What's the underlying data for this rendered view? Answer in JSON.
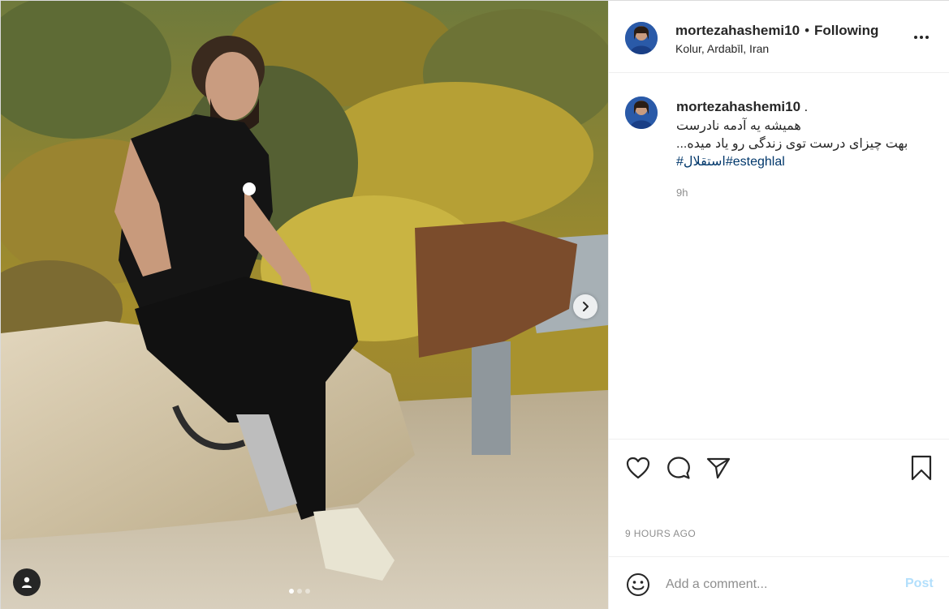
{
  "post": {
    "username": "mortezahashemi10",
    "follow_state": "Following",
    "header_separator": "•",
    "location": "Kolur, Ardabīl, Iran",
    "caption": {
      "username": "mortezahashemi10",
      "username_suffix": ".",
      "lines": [
        "همیشه یه آدمه نادرست",
        "بهت چیزای درست توی زندگی رو یاد میده..."
      ],
      "hashtags": [
        "#استقلال",
        "#esteghlal"
      ]
    },
    "relative_time": "9h",
    "timestamp": "9 HOURS AGO"
  },
  "media": {
    "carousel_count": 3,
    "carousel_active": 0,
    "icons": {
      "next": "chevron-right-icon",
      "tagged": "user-tag-icon"
    }
  },
  "actions": {
    "icons": [
      "heart-icon",
      "comment-icon",
      "share-icon",
      "bookmark-icon"
    ]
  },
  "comment": {
    "placeholder": "Add a comment...",
    "post_label": "Post",
    "emoji_icon": "emoji-icon"
  },
  "colors": {
    "text": "#262626",
    "secondary": "#8e8e8e",
    "link": "#00376b",
    "post_disabled": "#b2dffc",
    "border": "#efefef",
    "avatar_jersey": "#1f4f9c"
  }
}
